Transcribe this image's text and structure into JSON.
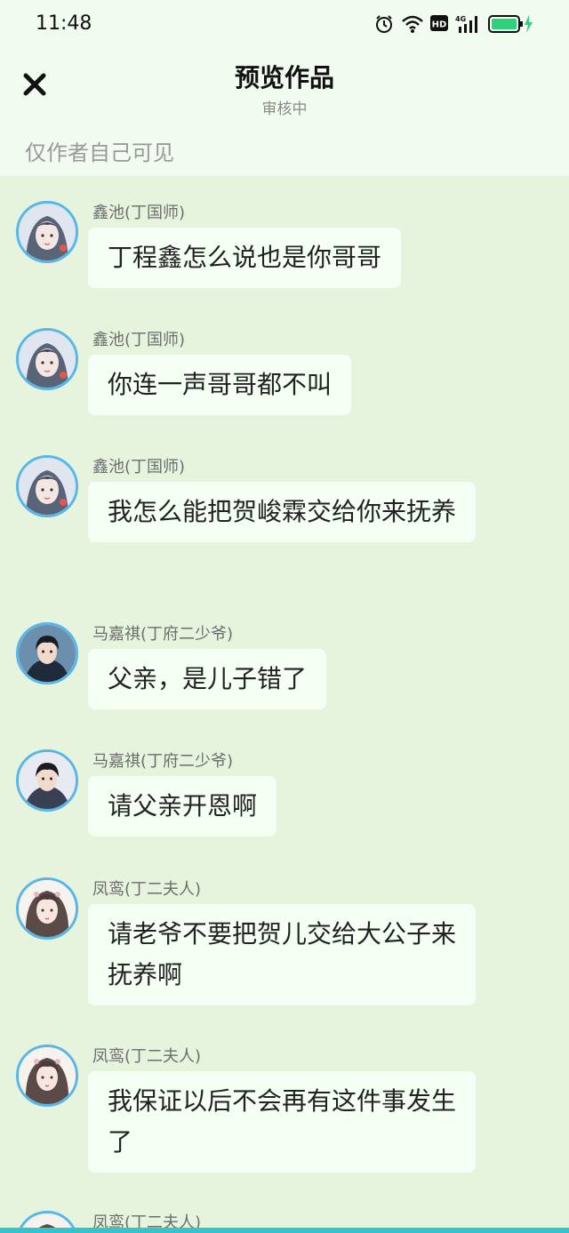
{
  "status_bar": {
    "time": "11:48"
  },
  "header": {
    "title": "预览作品",
    "subtitle": "审核中",
    "visibility_note": "仅作者自己可见"
  },
  "messages": [
    {
      "name": "鑫池(丁国师)",
      "text": "丁程鑫怎么说也是你哥哥",
      "avatar": "male-ancient-1"
    },
    {
      "name": "鑫池(丁国师)",
      "text": "你连一声哥哥都不叫",
      "avatar": "male-ancient-1"
    },
    {
      "name": "鑫池(丁国师)",
      "text": "我怎么能把贺峻霖交给你来抚养",
      "avatar": "male-ancient-1"
    },
    {
      "name": "马嘉祺(丁府二少爷)",
      "text": "父亲，是儿子错了",
      "avatar": "male-young"
    },
    {
      "name": "马嘉祺(丁府二少爷)",
      "text": "请父亲开恩啊",
      "avatar": "male-young"
    },
    {
      "name": "凤鸾(丁二夫人)",
      "text": "请老爷不要把贺儿交给大公子来抚养啊",
      "avatar": "female-ancient"
    },
    {
      "name": "凤鸾(丁二夫人)",
      "text": "我保证以后不会再有这件事发生了",
      "avatar": "female-ancient"
    },
    {
      "name": "凤鸾(丁二夫人)",
      "text": "",
      "avatar": "female-ancient"
    }
  ],
  "colors": {
    "page_background": "#e6f4de",
    "header_background": "#f2fbef",
    "bubble_background": "#f5fff4",
    "avatar_border": "#58b6e8",
    "battery_green": "#2fd17b"
  }
}
